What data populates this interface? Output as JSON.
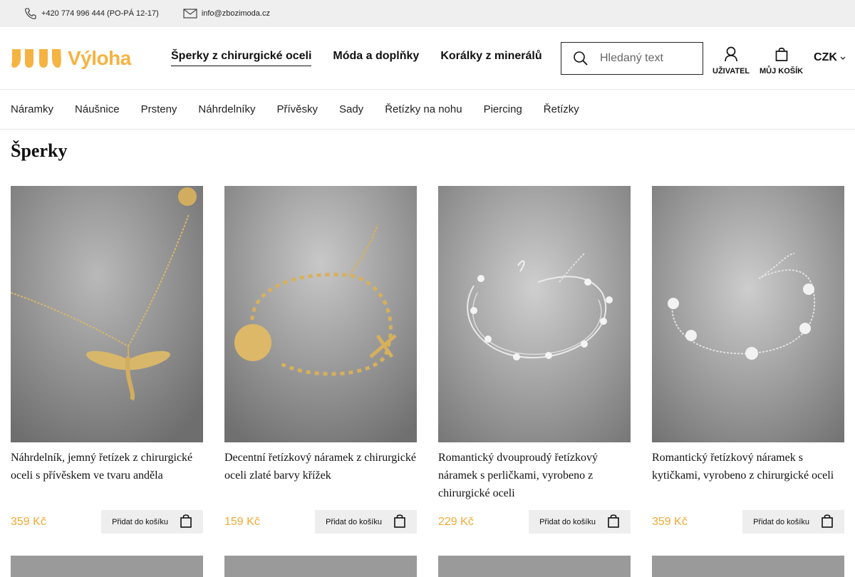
{
  "topbar": {
    "phone": "+420 774 996 444 (PO-PÁ 12-17)",
    "email": "info@zbozimoda.cz",
    "phone_icon": "phone-icon",
    "email_icon": "mail-icon"
  },
  "header": {
    "logo_text": "Výloha",
    "brand_color": "#f5b342",
    "nav": [
      {
        "label": "Šperky z chirurgické oceli",
        "active": true
      },
      {
        "label": "Móda a doplňky",
        "active": false
      },
      {
        "label": "Korálky z minerálů",
        "active": false
      }
    ],
    "search": {
      "placeholder": "Hledaný text"
    },
    "user_label": "UŽIVATEL",
    "cart_label": "MŮJ KOŠÍK",
    "currency": "CZK"
  },
  "categories": [
    "Náramky",
    "Náušnice",
    "Prsteny",
    "Náhrdelníky",
    "Přívěsky",
    "Sady",
    "Řetízky na nohu",
    "Piercing",
    "Řetízky"
  ],
  "page": {
    "title": "Šperky"
  },
  "products": [
    {
      "name": "Náhrdelník, jemný řetízek z chirurgické oceli s přívěskem ve tvaru anděla",
      "price": "359 Kč",
      "button": "Přidat do košíku",
      "image": "gold-dragonfly-necklace"
    },
    {
      "name": "Decentní řetízkový náramek z chirurgické oceli zlaté barvy křížek",
      "price": "159 Kč",
      "button": "Přidat do košíku",
      "image": "gold-cross-bracelet"
    },
    {
      "name": "Romantický dvouproudý řetízkový náramek s perličkami, vyrobeno z chirurgické oceli",
      "price": "229 Kč",
      "button": "Přidat do košíku",
      "image": "silver-pearl-bracelet"
    },
    {
      "name": "Romantický řetízkový náramek s kytičkami, vyrobeno z chirurgické oceli",
      "price": "359 Kč",
      "button": "Přidat do košíku",
      "image": "silver-flower-bracelet"
    }
  ],
  "colors": {
    "price": "#f0a933",
    "topbar_bg": "#efefef",
    "button_bg": "#eeeeee"
  }
}
